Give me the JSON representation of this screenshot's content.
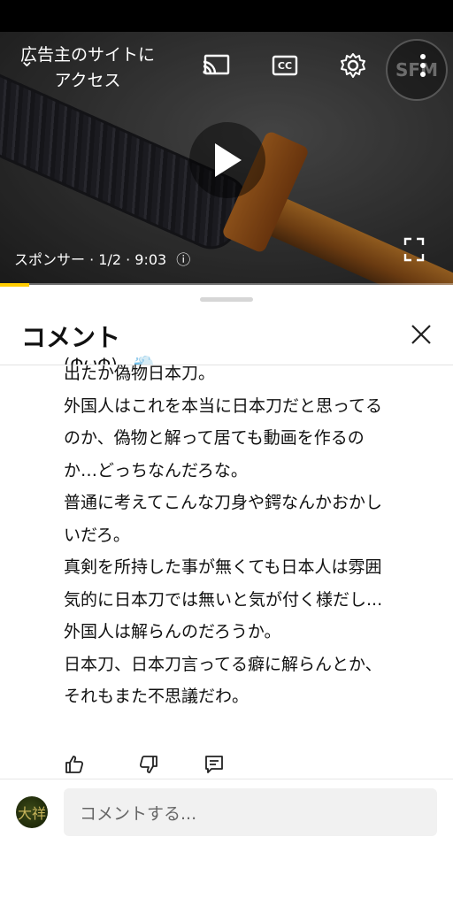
{
  "player": {
    "ad_link_text": "広告主のサイトにアクセス",
    "sponsor_info": "スポンサー · 1/2 · 9:03",
    "info_symbol": "ⓘ",
    "sponsor_badge": "SFM",
    "cc_label": "CC",
    "progress_fraction": 0.065,
    "accent_color": "#ffcc00"
  },
  "comments_panel": {
    "title": "コメント",
    "comment": {
      "lines": [
        "(ΦωΦ)...💨",
        "出たか偽物日本刀。",
        "外国人はこれを本当に日本刀だと思ってる",
        "のか、偽物と解って居ても動画を作るの",
        "か…どっちなんだろな。",
        "普通に考えてこんな刀身や鍔なんかおかし",
        "いだろ。",
        "真剣を所持した事が無くても日本人は雰囲",
        "気的に日本刀では無いと気が付く様だし...",
        "外国人は解らんのだろうか。",
        "日本刀、日本刀言ってる癖に解らんとか、",
        "それもまた不思議だわ。"
      ]
    },
    "composer": {
      "placeholder": "コメントする...",
      "avatar_text": "大祥"
    }
  }
}
